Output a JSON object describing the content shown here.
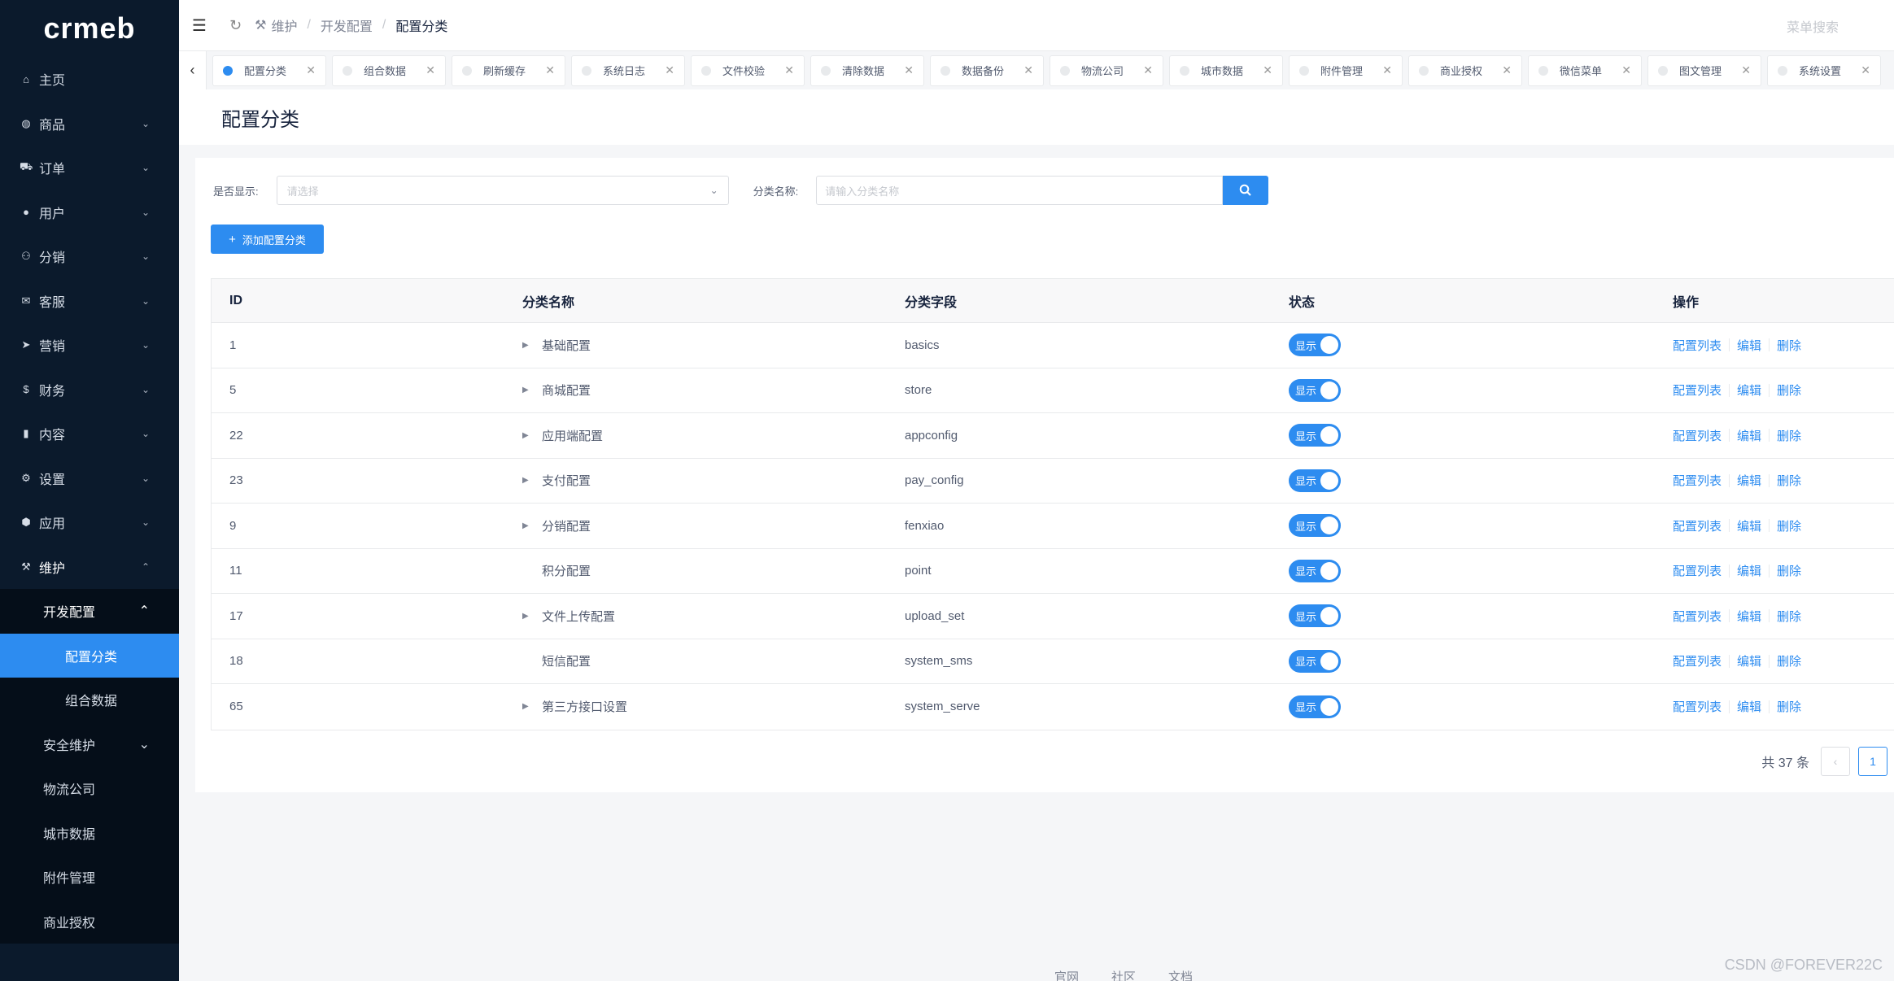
{
  "brand": {
    "logo": "crmeb"
  },
  "sidebar": {
    "items": [
      {
        "icon": "home-icon",
        "glyph": "⌂",
        "label": "主页",
        "chevron": ""
      },
      {
        "icon": "basket-icon",
        "glyph": "◍",
        "label": "商品",
        "chevron": "⌄"
      },
      {
        "icon": "cart-icon",
        "glyph": "⛟",
        "label": "订单",
        "chevron": "⌄"
      },
      {
        "icon": "user-icon",
        "glyph": "●",
        "label": "用户",
        "chevron": "⌄"
      },
      {
        "icon": "distribution-icon",
        "glyph": "⚇",
        "label": "分销",
        "chevron": "⌄"
      },
      {
        "icon": "chat-icon",
        "glyph": "✉",
        "label": "客服",
        "chevron": "⌄"
      },
      {
        "icon": "send-icon",
        "glyph": "➤",
        "label": "营销",
        "chevron": "⌄"
      },
      {
        "icon": "dollar-icon",
        "glyph": "$",
        "label": "财务",
        "chevron": "⌄"
      },
      {
        "icon": "book-icon",
        "glyph": "▮",
        "label": "内容",
        "chevron": "⌄"
      },
      {
        "icon": "gear-icon",
        "glyph": "⚙",
        "label": "设置",
        "chevron": "⌄"
      },
      {
        "icon": "cube-icon",
        "glyph": "⬢",
        "label": "应用",
        "chevron": "⌄"
      },
      {
        "icon": "hammer-icon",
        "glyph": "⚒",
        "label": "维护",
        "chevron": "⌃"
      }
    ],
    "sub": {
      "dev_config": "开发配置",
      "config_category": "配置分类",
      "group_data": "组合数据",
      "security": "安全维护",
      "logistics": "物流公司",
      "city_data": "城市数据",
      "attachment": "附件管理",
      "license": "商业授权"
    }
  },
  "header": {
    "breadcrumb": [
      "维护",
      "开发配置",
      "配置分类"
    ],
    "search_placeholder": "菜单搜索"
  },
  "tabs": [
    {
      "label": "配置分类",
      "active": true
    },
    {
      "label": "组合数据"
    },
    {
      "label": "刷新缓存"
    },
    {
      "label": "系统日志"
    },
    {
      "label": "文件校验"
    },
    {
      "label": "清除数据"
    },
    {
      "label": "数据备份"
    },
    {
      "label": "物流公司"
    },
    {
      "label": "城市数据"
    },
    {
      "label": "附件管理"
    },
    {
      "label": "商业授权"
    },
    {
      "label": "微信菜单"
    },
    {
      "label": "图文管理"
    },
    {
      "label": "系统设置"
    }
  ],
  "page": {
    "title": "配置分类"
  },
  "filters": {
    "show_label": "是否显示:",
    "show_placeholder": "请选择",
    "name_label": "分类名称:",
    "name_placeholder": "请输入分类名称"
  },
  "add_button": "添加配置分类",
  "table": {
    "headers": {
      "id": "ID",
      "name": "分类名称",
      "field": "分类字段",
      "status": "状态",
      "ops": "操作"
    },
    "status_text": "显示",
    "ops": {
      "list": "配置列表",
      "edit": "编辑",
      "delete": "删除"
    },
    "rows": [
      {
        "id": "1",
        "name": "基础配置",
        "field": "basics",
        "expandable": true
      },
      {
        "id": "5",
        "name": "商城配置",
        "field": "store",
        "expandable": true
      },
      {
        "id": "22",
        "name": "应用端配置",
        "field": "appconfig",
        "expandable": true
      },
      {
        "id": "23",
        "name": "支付配置",
        "field": "pay_config",
        "expandable": true
      },
      {
        "id": "9",
        "name": "分销配置",
        "field": "fenxiao",
        "expandable": true
      },
      {
        "id": "11",
        "name": "积分配置",
        "field": "point",
        "expandable": false
      },
      {
        "id": "17",
        "name": "文件上传配置",
        "field": "upload_set",
        "expandable": true
      },
      {
        "id": "18",
        "name": "短信配置",
        "field": "system_sms",
        "expandable": false
      },
      {
        "id": "65",
        "name": "第三方接口设置",
        "field": "system_serve",
        "expandable": true
      }
    ]
  },
  "pagination": {
    "total_text": "共 37 条",
    "current": "1"
  },
  "footer": {
    "links": [
      "官网",
      "社区",
      "文档"
    ]
  },
  "watermark": "CSDN @FOREVER22C",
  "colors": {
    "accent": "#2d8cf0",
    "sidebar_bg": "#0b1a2c"
  }
}
